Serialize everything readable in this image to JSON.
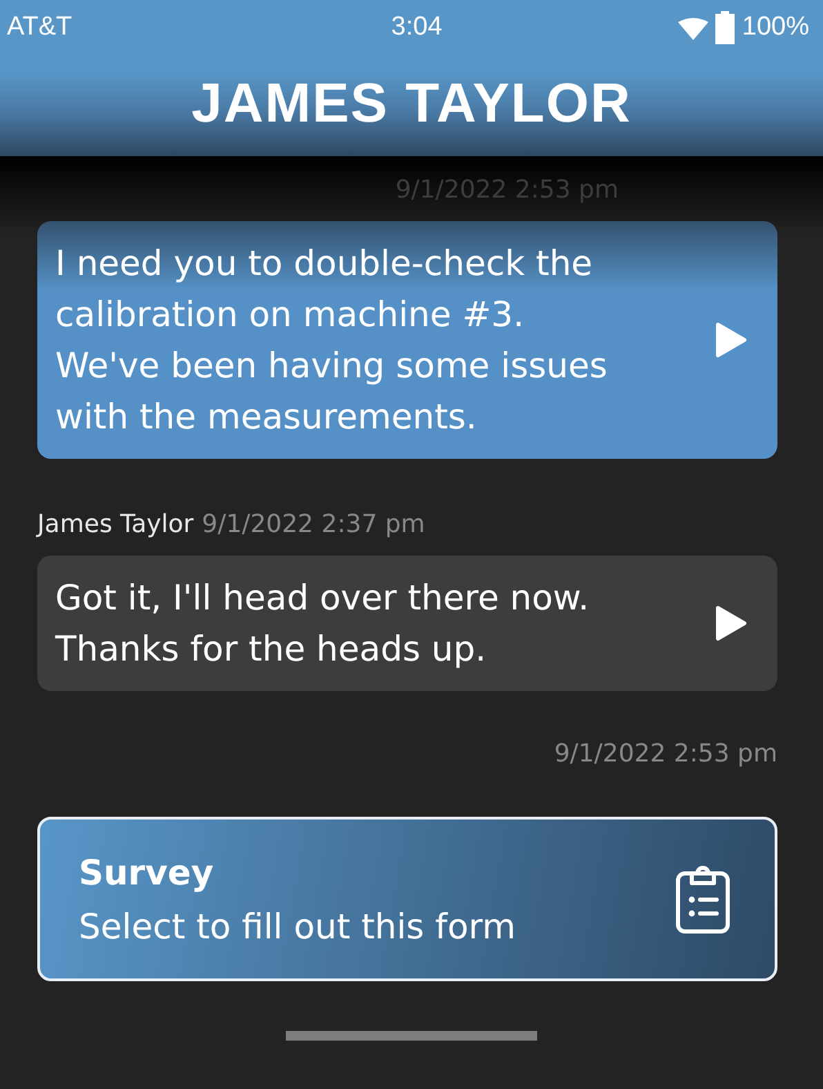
{
  "status_bar": {
    "carrier": "AT&T",
    "time": "3:04",
    "battery": "100%"
  },
  "header": {
    "title": "JAMES TAYLOR"
  },
  "messages": [
    {
      "kind": "timestamp",
      "text": "9/1/2022 2:53 pm"
    },
    {
      "kind": "sent",
      "text": "I need you to double-check the calibration on machine #3. We've been having some issues with the measurements."
    },
    {
      "kind": "sender",
      "name": "James Taylor",
      "time": "9/1/2022 2:37 pm"
    },
    {
      "kind": "received",
      "text": "Got it, I'll head over there now. Thanks for the heads up."
    },
    {
      "kind": "timestamp",
      "text": "9/1/2022 2:53 pm"
    }
  ],
  "survey": {
    "title": "Survey",
    "subtitle": "Select to fill out this form"
  }
}
